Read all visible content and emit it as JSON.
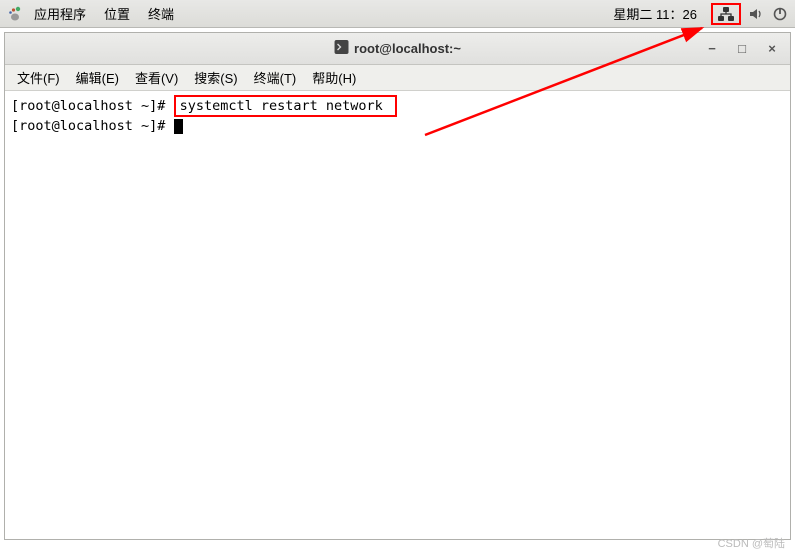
{
  "topPanel": {
    "applications": "应用程序",
    "places": "位置",
    "terminal": "终端",
    "clock": "星期二 11：26"
  },
  "window": {
    "title": "root@localhost:~"
  },
  "menus": {
    "file": "文件(F)",
    "edit": "编辑(E)",
    "view": "查看(V)",
    "search": "搜索(S)",
    "terminal": "终端(T)",
    "help": "帮助(H)"
  },
  "term": {
    "prompt1": "[root@localhost ~]# ",
    "cmd1": "systemctl restart network ",
    "prompt2": "[root@localhost ~]# "
  },
  "watermark": "CSDN @萄陆"
}
